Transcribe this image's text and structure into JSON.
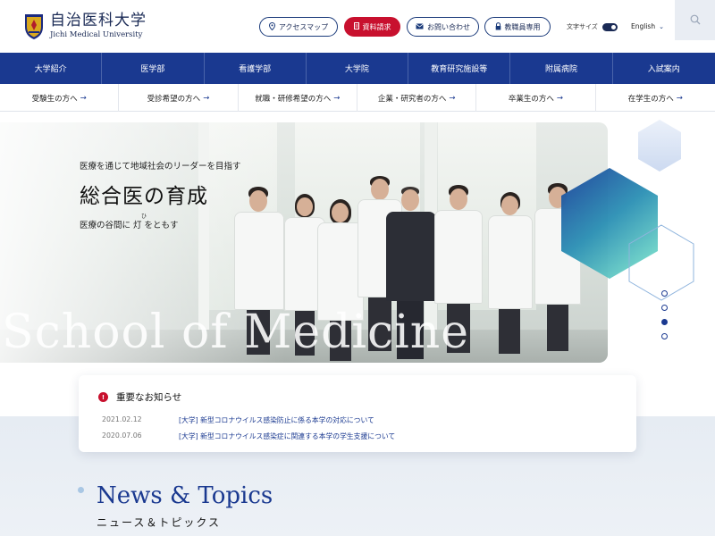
{
  "header": {
    "logo_jp": "自治医科大学",
    "logo_en": "Jichi Medical University",
    "buttons": {
      "access": "アクセスマップ",
      "request": "資料請求",
      "contact": "お問い合わせ",
      "staff": "教職員専用"
    },
    "font_size_label": "文字サイズ",
    "language": "English"
  },
  "main_nav": [
    {
      "label": "大学紹介"
    },
    {
      "label": "医学部"
    },
    {
      "label": "看護学部"
    },
    {
      "label": "大学院"
    },
    {
      "label": "教育研究施設等"
    },
    {
      "label": "附属病院"
    },
    {
      "label": "入試案内"
    }
  ],
  "sub_nav": [
    {
      "label": "受験生の方へ"
    },
    {
      "label": "受診希望の方へ"
    },
    {
      "label": "就職・研修希望の方へ"
    },
    {
      "label": "企業・研究者の方へ"
    },
    {
      "label": "卒業生の方へ"
    },
    {
      "label": "在学生の方へ"
    }
  ],
  "hero": {
    "lead": "医療を通じて地域社会のリーダーを目指す",
    "title": "総合医の育成",
    "subtitle": "医療の谷間に 灯 をともす",
    "ruby": "ひ",
    "background_text": "School of Medicine",
    "slide_count": 4,
    "active_slide": 3
  },
  "notice": {
    "title": "重要なお知らせ",
    "items": [
      {
        "date": "2021.02.12",
        "text": "[大学] 新型コロナウイルス感染防止に係る本学の対応について"
      },
      {
        "date": "2020.07.06",
        "text": "[大学] 新型コロナウイルス感染症に関連する本学の学生支援について"
      }
    ]
  },
  "news": {
    "title": "News & Topics",
    "subtitle": "ニュース＆トピックス"
  },
  "colors": {
    "brand_navy": "#1a3990",
    "accent_red": "#c8102e",
    "text_dark": "#222222"
  }
}
